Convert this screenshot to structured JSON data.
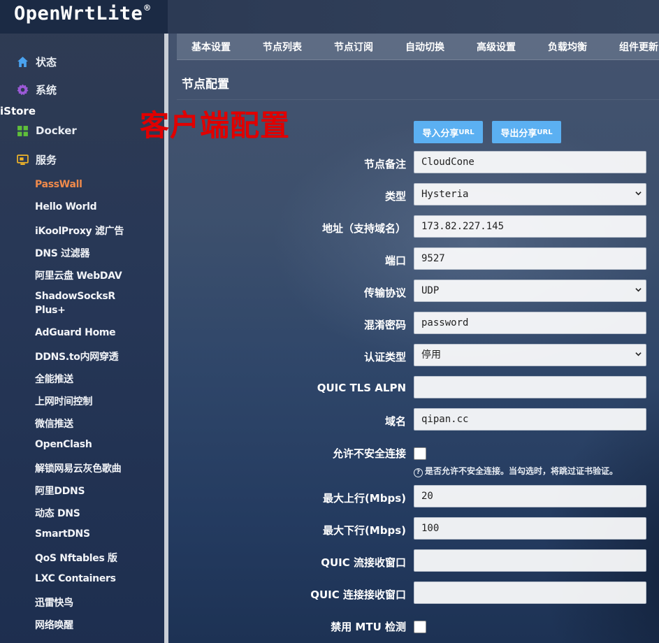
{
  "brand": {
    "name": "OpenWrtLite",
    "mark": "®"
  },
  "sidebar": {
    "top": [
      {
        "label": "状态",
        "icon": "home-icon"
      },
      {
        "label": "系统",
        "icon": "gear-icon"
      }
    ],
    "istore": "iStore",
    "docker": {
      "label": "Docker",
      "icon": "docker-grid-icon"
    },
    "services": {
      "label": "服务",
      "icon": "services-icon"
    },
    "items": [
      "PassWall",
      "Hello World",
      "iKoolProxy 滤广告",
      "DNS 过滤器",
      "阿里云盘 WebDAV",
      "ShadowSocksR",
      "Plus+",
      "AdGuard Home",
      "DDNS.to内网穿透",
      "全能推送",
      "上网时间控制",
      "微信推送",
      "OpenClash",
      "解锁网易云灰色歌曲",
      "阿里DDNS",
      "动态 DNS",
      "SmartDNS",
      "QoS Nftables 版",
      "LXC Containers",
      "迅雷快鸟",
      "网络唤醒"
    ],
    "active_index": 0
  },
  "tabs": [
    "基本设置",
    "节点列表",
    "节点订阅",
    "自动切换",
    "高级设置",
    "负载均衡",
    "组件更新"
  ],
  "section_title": "节点配置",
  "overlay_text": "客户端配置",
  "buttons": {
    "import": "导入分享",
    "import_suffix": "URL",
    "export": "导出分享",
    "export_suffix": "URL"
  },
  "form": {
    "remark": {
      "label": "节点备注",
      "value": "CloudCone"
    },
    "type": {
      "label": "类型",
      "value": "Hysteria"
    },
    "address": {
      "label": "地址（支持域名）",
      "value": "173.82.227.145"
    },
    "port": {
      "label": "端口",
      "value": "9527"
    },
    "protocol": {
      "label": "传输协议",
      "value": "UDP"
    },
    "obfs": {
      "label": "混淆密码",
      "value": "password"
    },
    "auth_type": {
      "label": "认证类型",
      "value": "停用"
    },
    "alpn": {
      "label": "QUIC TLS ALPN",
      "value": ""
    },
    "domain": {
      "label": "域名",
      "value": "qipan.cc"
    },
    "insecure": {
      "label": "允许不安全连接",
      "checked": false,
      "hint": "是否允许不安全连接。当勾选时，将跳过证书验证。"
    },
    "up": {
      "label": "最大上行(Mbps)",
      "value": "20"
    },
    "down": {
      "label": "最大下行(Mbps)",
      "value": "100"
    },
    "stream_window": {
      "label": "QUIC 流接收窗口",
      "value": ""
    },
    "conn_window": {
      "label": "QUIC 连接接收窗口",
      "value": ""
    },
    "disable_mtu": {
      "label": "禁用 MTU 检测",
      "checked": false
    }
  },
  "colors": {
    "accent": "#5bb0f2",
    "active": "#f08a4b",
    "overlay": "#e00000"
  }
}
